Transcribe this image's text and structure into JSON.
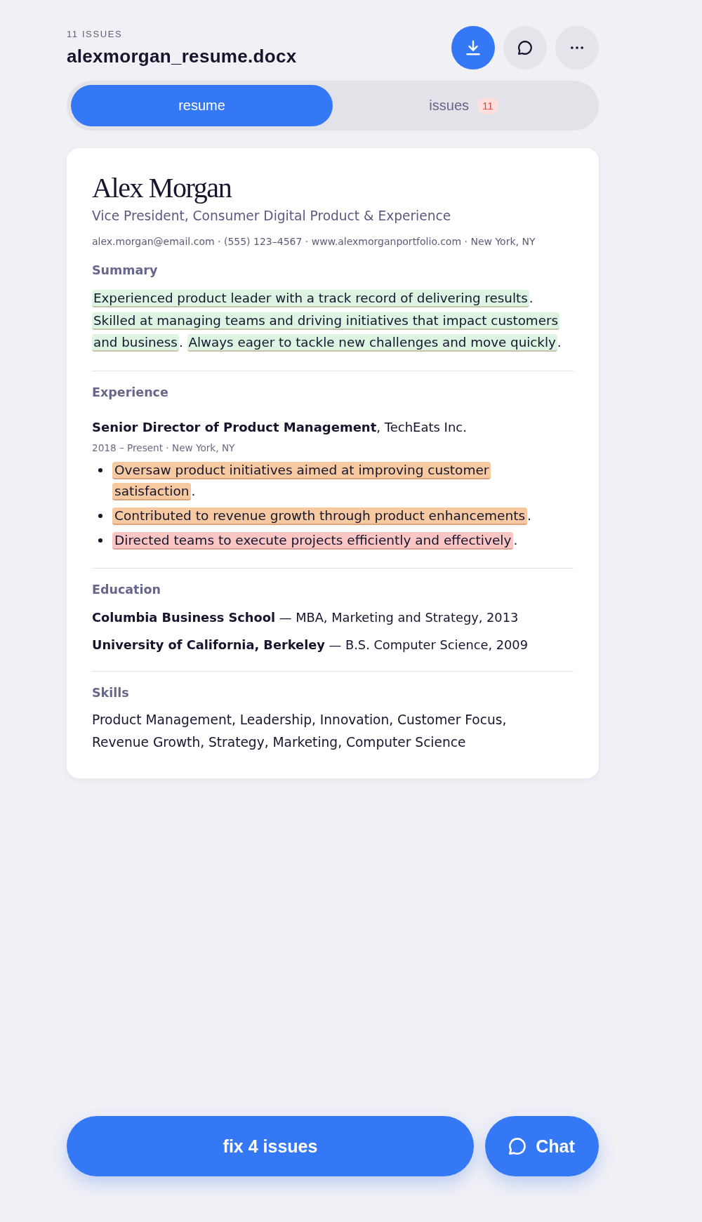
{
  "header": {
    "issue_count": "11 ISSUES",
    "filename": "alexmorgan_resume.docx"
  },
  "tabs": [
    {
      "label": "resume",
      "selected": true
    },
    {
      "label": "issues",
      "selected": false,
      "badge": "11"
    }
  ],
  "resume": {
    "name": "Alex Morgan",
    "headline": "Vice President, Consumer Digital Product & Experience",
    "contact": "alex.morgan@email.com · (555) 123–4567 · www.alexmorganportfolio.com · New York, NY",
    "sections": [
      {
        "kind": "summary",
        "heading": "Summary",
        "segments": [
          {
            "text": "Experienced product leader with a track record of delivering results",
            "color": "#dcf4e1"
          },
          {
            "text": ". "
          },
          {
            "text": "Skilled at managing teams and driving initiatives that impact customers and business",
            "color": "#dcf4e1"
          },
          {
            "text": ". "
          },
          {
            "text": "Always eager to tackle new challenges and move quickly",
            "color": "#dcf4e1"
          },
          {
            "text": "."
          }
        ]
      },
      {
        "kind": "experience",
        "heading": "Experience",
        "jobs": [
          {
            "title": "**Senior Director of Product Management**, TechEats Inc.",
            "meta": "2018 – Present · New York, NY",
            "bullets": [
              {
                "segments": [
                  {
                    "text": "Oversaw product initiatives aimed at improving customer satisfaction",
                    "color": "#f7c9a1"
                  },
                  {
                    "text": "."
                  }
                ]
              },
              {
                "segments": [
                  {
                    "text": "Contributed to revenue growth through product enhancements",
                    "color": "#f7c9a1"
                  },
                  {
                    "text": "."
                  }
                ]
              },
              {
                "segments": [
                  {
                    "text": "Directed teams to execute projects efficiently and effectively",
                    "color": "#f9c6c4"
                  },
                  {
                    "text": "."
                  }
                ]
              }
            ]
          }
        ]
      },
      {
        "kind": "education",
        "heading": "Education",
        "entries": [
          "**Columbia Business School** — MBA, Marketing and Strategy, 2013",
          "**University of California, Berkeley** — B.S. Computer Science, 2009"
        ]
      },
      {
        "kind": "skills",
        "heading": "Skills",
        "text": "Product Management, Leadership, Innovation, Customer Focus, Revenue Growth, Strategy, Marketing, Computer Science"
      }
    ]
  },
  "footer": {
    "fix_button": "fix 4 issues",
    "chat_button": "Chat"
  }
}
